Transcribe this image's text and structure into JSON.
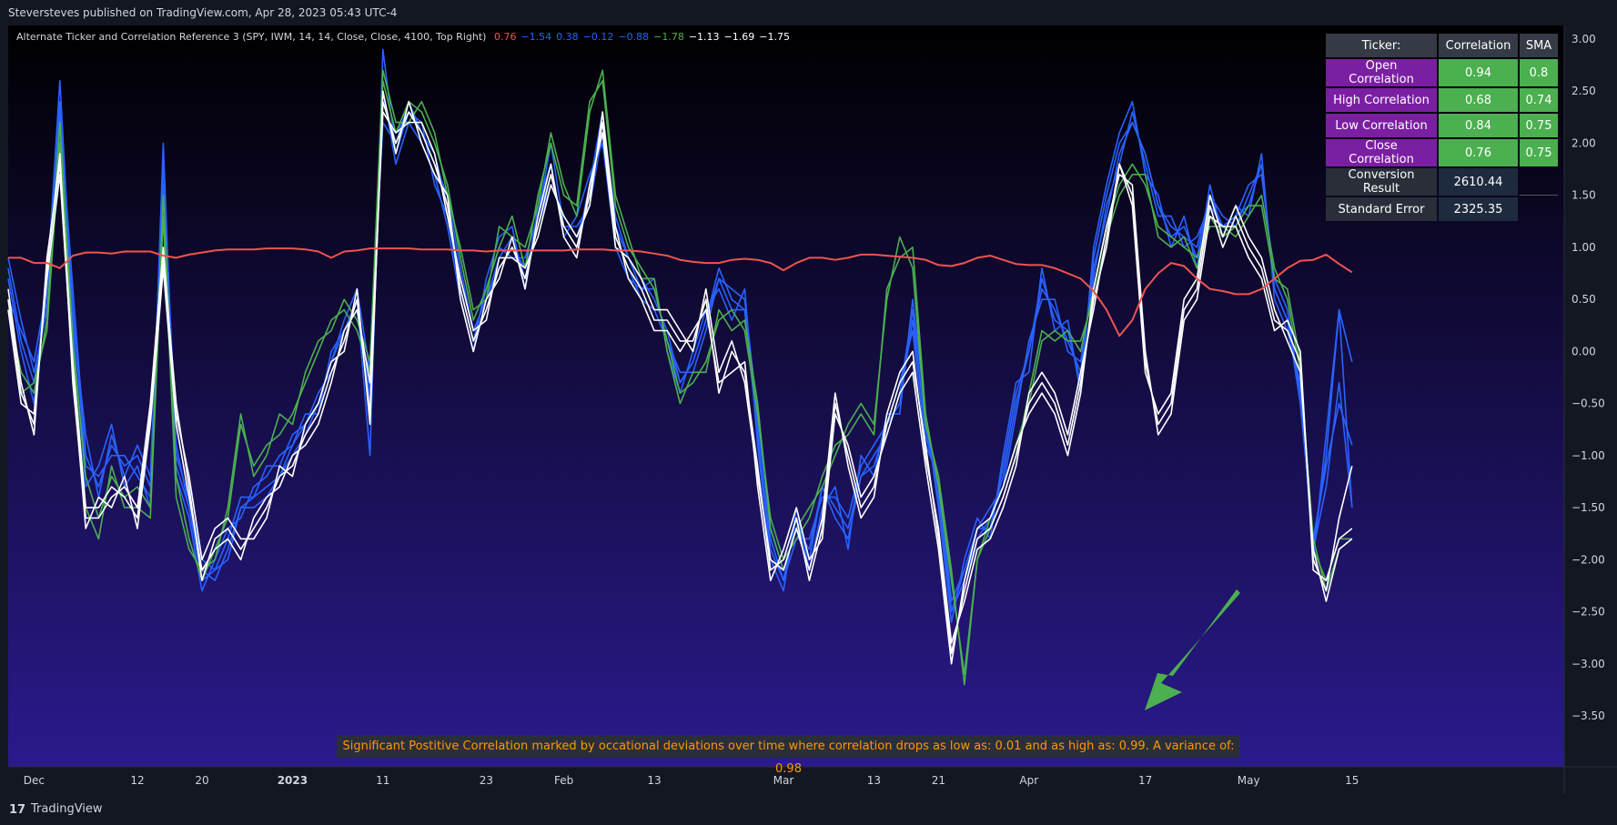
{
  "header": {
    "published": "Steversteves published on TradingView.com, Apr 28, 2023 05:43 UTC-4"
  },
  "legend": {
    "title": "Alternate Ticker and Correlation Reference 3 (SPY, IWM, 14, 14, Close, Close, 4100, Top Right)",
    "values": [
      {
        "text": "0.76",
        "color": "#ef5350"
      },
      {
        "text": "−1.54",
        "color": "#2962ff"
      },
      {
        "text": "0.38",
        "color": "#2962ff"
      },
      {
        "text": "−0.12",
        "color": "#2962ff"
      },
      {
        "text": "−0.88",
        "color": "#2962ff"
      },
      {
        "text": "−1.78",
        "color": "#4caf50"
      },
      {
        "text": "−1.13",
        "color": "#ffffff"
      },
      {
        "text": "−1.69",
        "color": "#ffffff"
      },
      {
        "text": "−1.75",
        "color": "#ffffff"
      }
    ]
  },
  "table": {
    "headers": [
      "Ticker:",
      "Correlation",
      "SMA"
    ],
    "rows": [
      {
        "label": "Open Correlation",
        "corr": "0.94",
        "sma": "0.8"
      },
      {
        "label": "High Correlation",
        "corr": "0.68",
        "sma": "0.74"
      },
      {
        "label": "Low Correlation",
        "corr": "0.84",
        "sma": "0.75"
      },
      {
        "label": "Close Correlation",
        "corr": "0.76",
        "sma": "0.75"
      }
    ],
    "conversion": {
      "label": "Conversion Result",
      "value": "2610.44"
    },
    "stderr": {
      "label": "Standard Error",
      "value": "2325.35"
    }
  },
  "annotation": "Significant Postitive Correlation marked by occational deviations over time where correlation drops as low as: 0.01 and as high as: 0.99. A variance of: 0.98",
  "footer": {
    "brand": "TradingView",
    "logo_text": "17"
  },
  "colors": {
    "correlation": "#ef5350",
    "blue": "#2962ff",
    "green": "#4caf50",
    "white": "#ffffff",
    "arrow": "#4caf50",
    "bg_top": "#000000",
    "bg_bottom": "#2a1a8c"
  },
  "chart_data": {
    "type": "line",
    "ylim": [
      -3.5,
      3.0
    ],
    "y_ticks": [
      "3.00",
      "2.50",
      "2.00",
      "1.50",
      "1.00",
      "0.50",
      "0.00",
      "−0.50",
      "−1.00",
      "−1.50",
      "−2.00",
      "−2.50",
      "−3.00",
      "−3.50"
    ],
    "x_ticks": [
      "Dec",
      "12",
      "20",
      "2023",
      "11",
      "23",
      "Feb",
      "13",
      "Mar",
      "13",
      "21",
      "Apr",
      "17",
      "May",
      "15"
    ],
    "bold_x_ticks": [
      "2023"
    ],
    "sessions_visible": 105,
    "x_tick_sessions": [
      2,
      10,
      15,
      22,
      29,
      37,
      43,
      50,
      60,
      67,
      72,
      79,
      88,
      96,
      104
    ],
    "series": [
      {
        "color": "blue",
        "values": [
          0.9,
          0.3,
          -0.2,
          0.4,
          2.3,
          0.6,
          -1.0,
          -1.3,
          -0.9,
          -1.1,
          -1.0,
          -1.3,
          1.8,
          -0.9,
          -1.5,
          -2.1,
          -2.2,
          -1.9,
          -1.5,
          -1.5,
          -1.4,
          -1.2,
          -1.0,
          -0.8,
          -0.5,
          -0.1,
          0.3,
          0.6,
          -0.2,
          2.2,
          2.0,
          2.4,
          2.1,
          1.8,
          1.5,
          0.8,
          0.2,
          0.5,
          0.8,
          1.0,
          0.8,
          1.2,
          1.6,
          1.3,
          1.1,
          1.5,
          2.2,
          1.3,
          0.9,
          0.7,
          0.5,
          0.2,
          -0.3,
          -0.1,
          0.3,
          0.8,
          0.5,
          0.4,
          -0.7,
          -1.7,
          -2.1,
          -1.7,
          -1.9,
          -1.3,
          -1.5,
          -1.7,
          -1.2,
          -1.0,
          -0.8,
          -0.4,
          0.4,
          -0.8,
          -1.3,
          -2.5,
          -2.2,
          -1.8,
          -1.6,
          -1.2,
          -0.5,
          0.0,
          0.6,
          0.4,
          0.1,
          -0.2,
          0.8,
          1.3,
          1.9,
          2.2,
          1.9,
          1.4,
          1.2,
          1.1,
          1.0,
          1.5,
          1.3,
          1.2,
          1.5,
          1.8,
          0.6,
          0.3,
          -0.5,
          -1.8,
          -1.1,
          -0.5,
          -0.9
        ]
      },
      {
        "color": "blue",
        "values": [
          0.7,
          0.0,
          -0.5,
          0.8,
          2.1,
          0.2,
          -1.3,
          -1.1,
          -0.7,
          -1.3,
          -1.1,
          -1.5,
          2.0,
          -1.2,
          -1.6,
          -2.3,
          -2.0,
          -1.7,
          -1.6,
          -1.3,
          -1.2,
          -1.0,
          -0.9,
          -0.6,
          -0.6,
          0.0,
          0.2,
          0.4,
          -0.5,
          2.5,
          1.8,
          2.2,
          2.0,
          1.7,
          1.2,
          0.5,
          0.0,
          0.7,
          1.1,
          1.2,
          0.6,
          1.4,
          1.8,
          1.1,
          1.3,
          1.7,
          2.0,
          1.0,
          0.7,
          0.6,
          0.7,
          0.0,
          -0.4,
          0.0,
          0.4,
          0.6,
          0.3,
          0.6,
          -0.9,
          -2.0,
          -2.3,
          -1.5,
          -2.1,
          -1.5,
          -1.3,
          -1.9,
          -1.0,
          -1.2,
          -0.6,
          -0.6,
          0.5,
          -0.6,
          -1.5,
          -2.6,
          -2.0,
          -1.6,
          -1.8,
          -1.0,
          -0.3,
          -0.2,
          0.8,
          0.2,
          0.3,
          -0.4,
          1.0,
          1.6,
          2.1,
          2.4,
          1.7,
          1.5,
          1.0,
          1.3,
          0.8,
          1.6,
          1.1,
          1.4,
          1.3,
          1.9,
          0.5,
          0.2,
          -0.3,
          -2.0,
          -0.8,
          0.4,
          -0.1
        ]
      },
      {
        "color": "blue",
        "values": [
          0.5,
          0.2,
          -0.1,
          0.6,
          2.6,
          0.3,
          -0.8,
          -1.4,
          -0.8,
          -1.2,
          -0.9,
          -1.2,
          1.6,
          -1.0,
          -1.4,
          -2.0,
          -2.1,
          -1.8,
          -1.4,
          -1.4,
          -1.1,
          -1.1,
          -0.8,
          -0.7,
          -0.4,
          -0.2,
          0.1,
          0.5,
          -1.0,
          2.9,
          1.9,
          2.3,
          2.2,
          1.6,
          1.3,
          0.6,
          0.1,
          0.6,
          1.0,
          0.9,
          0.9,
          1.3,
          2.0,
          1.2,
          1.0,
          1.6,
          2.3,
          1.1,
          0.8,
          0.5,
          0.4,
          0.1,
          -0.2,
          -0.2,
          0.2,
          0.7,
          0.6,
          0.5,
          -0.6,
          -1.8,
          -2.2,
          -1.8,
          -1.8,
          -1.4,
          -1.4,
          -1.6,
          -1.1,
          -0.9,
          -0.7,
          -0.3,
          0.2,
          -0.9,
          -1.2,
          -2.4,
          -2.1,
          -1.7,
          -1.5,
          -1.3,
          -0.6,
          0.1,
          0.5,
          0.5,
          0.0,
          -0.1,
          0.7,
          1.4,
          1.8,
          2.3,
          1.8,
          1.3,
          1.3,
          1.0,
          1.1,
          1.4,
          1.2,
          1.3,
          1.6,
          1.7,
          0.7,
          0.4,
          -0.4,
          -1.9,
          -1.3,
          -0.3,
          -1.5
        ]
      },
      {
        "color": "blue",
        "values": [
          0.8,
          0.1,
          -0.3,
          0.5,
          2.4,
          0.4,
          -1.1,
          -1.2,
          -1.0,
          -1.0,
          -1.2,
          -1.4,
          1.9,
          -1.1,
          -1.5,
          -2.2,
          -2.1,
          -2.0,
          -1.5,
          -1.4,
          -1.3,
          -1.2,
          -0.9,
          -0.7,
          -0.5,
          -0.1,
          0.2,
          0.5,
          -0.4,
          2.3,
          2.1,
          2.3,
          2.1,
          1.9,
          1.4,
          0.7,
          0.2,
          0.5,
          0.9,
          1.1,
          0.7,
          1.3,
          1.7,
          1.2,
          1.2,
          1.4,
          2.1,
          1.2,
          0.9,
          0.6,
          0.6,
          0.1,
          -0.3,
          -0.1,
          0.3,
          0.7,
          0.4,
          0.4,
          -0.8,
          -1.9,
          -2.2,
          -1.6,
          -2.0,
          -1.3,
          -1.6,
          -1.8,
          -1.2,
          -1.1,
          -0.7,
          -0.5,
          0.3,
          -0.7,
          -1.4,
          -2.5,
          -2.1,
          -1.7,
          -1.7,
          -1.1,
          -0.4,
          0.0,
          0.7,
          0.3,
          0.2,
          -0.3,
          0.9,
          1.5,
          2.0,
          2.2,
          1.9,
          1.4,
          1.1,
          1.2,
          0.9,
          1.5,
          1.2,
          1.3,
          1.4,
          1.8,
          0.6,
          0.3,
          -0.4,
          -1.9,
          -1.0,
          0.4,
          -1.5
        ]
      },
      {
        "color": "green",
        "values": [
          0.4,
          -0.2,
          -0.4,
          0.3,
          2.2,
          0.1,
          -1.2,
          -1.6,
          -1.2,
          -1.4,
          -1.3,
          -1.5,
          1.5,
          -1.2,
          -1.8,
          -2.2,
          -1.9,
          -1.6,
          -0.7,
          -1.1,
          -0.9,
          -0.8,
          -0.6,
          -0.3,
          0.0,
          0.3,
          0.4,
          0.2,
          -0.2,
          2.6,
          2.1,
          2.4,
          2.3,
          2.0,
          1.6,
          0.9,
          0.3,
          0.6,
          1.0,
          1.3,
          0.8,
          1.5,
          2.0,
          1.5,
          1.4,
          2.4,
          2.6,
          1.4,
          1.0,
          0.8,
          0.6,
          0.1,
          -0.4,
          -0.3,
          -0.1,
          0.3,
          0.4,
          0.2,
          -0.6,
          -1.6,
          -2.0,
          -1.8,
          -1.6,
          -1.2,
          -0.9,
          -0.8,
          -0.6,
          -0.8,
          0.6,
          0.9,
          1.0,
          -0.6,
          -1.3,
          -2.2,
          -3.1,
          -2.0,
          -1.7,
          -1.4,
          -1.0,
          -0.4,
          0.2,
          0.1,
          0.2,
          0.0,
          0.6,
          1.2,
          1.6,
          1.8,
          1.6,
          1.2,
          1.1,
          1.0,
          0.9,
          1.2,
          1.2,
          1.1,
          1.3,
          1.5,
          0.8,
          0.5,
          -0.2,
          -1.8,
          -2.3,
          -1.9,
          -1.8
        ]
      },
      {
        "color": "green",
        "values": [
          0.5,
          -0.4,
          -0.3,
          0.2,
          2.0,
          0.0,
          -1.5,
          -1.8,
          -1.1,
          -1.5,
          -1.5,
          -1.6,
          1.3,
          -1.4,
          -1.9,
          -2.1,
          -2.0,
          -1.5,
          -0.6,
          -1.2,
          -1.0,
          -0.6,
          -0.7,
          -0.2,
          0.1,
          0.2,
          0.5,
          0.3,
          -0.1,
          2.7,
          2.2,
          2.2,
          2.4,
          2.1,
          1.5,
          1.0,
          0.4,
          0.5,
          1.2,
          1.1,
          1.0,
          1.4,
          2.1,
          1.6,
          1.3,
          2.3,
          2.7,
          1.5,
          1.1,
          0.7,
          0.7,
          0.0,
          -0.5,
          -0.2,
          -0.2,
          0.4,
          0.2,
          0.3,
          -0.5,
          -1.7,
          -2.1,
          -1.7,
          -1.5,
          -1.3,
          -1.0,
          -0.7,
          -0.5,
          -0.7,
          0.5,
          1.1,
          0.8,
          -0.7,
          -1.2,
          -2.1,
          -3.2,
          -2.0,
          -1.6,
          -1.3,
          -0.9,
          -0.5,
          0.1,
          0.2,
          0.1,
          0.1,
          0.5,
          1.1,
          1.5,
          1.7,
          1.7,
          1.1,
          1.0,
          1.1,
          0.8,
          1.3,
          1.1,
          1.2,
          1.4,
          1.4,
          0.7,
          0.6,
          -0.1,
          -1.9,
          -2.2,
          -1.8,
          -1.8
        ]
      },
      {
        "color": "white",
        "values": [
          0.6,
          -0.3,
          -0.8,
          0.9,
          1.8,
          -0.1,
          -1.5,
          -1.5,
          -1.3,
          -1.4,
          -1.6,
          -0.6,
          0.9,
          -0.5,
          -1.3,
          -2.2,
          -1.8,
          -1.7,
          -1.9,
          -1.7,
          -1.5,
          -1.2,
          -1.1,
          -0.8,
          -0.6,
          -0.2,
          0.1,
          0.5,
          -0.6,
          2.4,
          2.0,
          2.3,
          2.1,
          1.8,
          1.4,
          0.6,
          0.1,
          0.4,
          0.8,
          1.0,
          0.7,
          1.2,
          1.7,
          1.2,
          1.0,
          1.5,
          2.2,
          1.1,
          0.8,
          0.6,
          0.3,
          0.3,
          0.1,
          0.1,
          0.5,
          -0.4,
          0.0,
          -0.2,
          -1.1,
          -2.1,
          -2.0,
          -1.6,
          -2.2,
          -1.7,
          -0.5,
          -1.0,
          -1.5,
          -1.3,
          -0.7,
          -0.3,
          -0.1,
          -0.9,
          -1.8,
          -2.9,
          -2.3,
          -1.8,
          -1.7,
          -1.4,
          -1.0,
          -0.5,
          -0.3,
          -0.5,
          -0.9,
          -0.3,
          0.5,
          1.0,
          1.8,
          1.5,
          -0.1,
          -0.7,
          -0.5,
          0.4,
          0.6,
          1.4,
          1.0,
          1.3,
          1.0,
          0.8,
          0.3,
          0.2,
          -0.1,
          -2.0,
          -2.3,
          -1.6,
          -1.1
        ]
      },
      {
        "color": "white",
        "values": [
          0.4,
          -0.5,
          -0.6,
          0.7,
          1.7,
          -0.2,
          -1.7,
          -1.4,
          -1.5,
          -1.2,
          -1.7,
          -0.7,
          0.8,
          -0.7,
          -1.4,
          -2.1,
          -1.9,
          -1.8,
          -2.0,
          -1.6,
          -1.4,
          -1.3,
          -1.0,
          -0.9,
          -0.7,
          -0.3,
          0.2,
          0.4,
          -0.3,
          2.3,
          2.1,
          2.2,
          2.2,
          1.9,
          1.3,
          0.7,
          0.2,
          0.3,
          0.9,
          0.9,
          0.8,
          1.1,
          1.6,
          1.3,
          1.1,
          1.4,
          2.3,
          1.2,
          0.7,
          0.5,
          0.2,
          0.2,
          0.0,
          0.2,
          0.4,
          -0.3,
          -0.2,
          -0.1,
          -1.3,
          -2.2,
          -1.9,
          -1.5,
          -2.0,
          -1.8,
          -0.6,
          -0.9,
          -1.4,
          -1.2,
          -0.8,
          -0.4,
          -0.2,
          -1.1,
          -1.9,
          -3.0,
          -2.2,
          -1.7,
          -1.6,
          -1.3,
          -0.9,
          -0.6,
          -0.4,
          -0.6,
          -1.0,
          -0.4,
          0.6,
          1.2,
          1.7,
          1.6,
          0.0,
          -0.8,
          -0.6,
          0.3,
          0.5,
          1.3,
          1.2,
          1.2,
          0.9,
          0.7,
          0.2,
          0.3,
          0.0,
          -2.1,
          -2.2,
          -1.8,
          -1.7
        ]
      },
      {
        "color": "white",
        "values": [
          0.5,
          -0.4,
          -0.7,
          0.8,
          1.9,
          -0.3,
          -1.6,
          -1.6,
          -1.4,
          -1.3,
          -1.5,
          -0.5,
          1.0,
          -0.6,
          -1.2,
          -2.0,
          -1.7,
          -1.6,
          -1.8,
          -1.8,
          -1.6,
          -1.1,
          -1.2,
          -0.7,
          -0.5,
          -0.1,
          0.0,
          0.6,
          -0.7,
          2.5,
          1.9,
          2.4,
          2.0,
          1.7,
          1.5,
          0.5,
          0.0,
          0.5,
          0.7,
          1.1,
          0.6,
          1.3,
          1.8,
          1.1,
          0.9,
          1.6,
          2.1,
          1.0,
          0.9,
          0.7,
          0.4,
          0.4,
          0.2,
          0.0,
          0.6,
          -0.2,
          0.1,
          -0.3,
          -1.2,
          -2.0,
          -2.1,
          -1.7,
          -2.1,
          -1.6,
          -0.4,
          -1.1,
          -1.6,
          -1.4,
          -0.6,
          -0.2,
          0.0,
          -1.0,
          -1.7,
          -2.8,
          -2.4,
          -1.9,
          -1.8,
          -1.5,
          -1.1,
          -0.4,
          -0.2,
          -0.4,
          -0.8,
          -0.2,
          0.4,
          1.1,
          1.8,
          1.4,
          -0.2,
          -0.6,
          -0.4,
          0.5,
          0.7,
          1.5,
          1.1,
          1.4,
          1.1,
          0.9,
          0.4,
          0.1,
          -0.2,
          -1.9,
          -2.4,
          -1.9,
          -1.8
        ]
      },
      {
        "color": "correlation",
        "values": [
          0.9,
          0.9,
          0.85,
          0.85,
          0.8,
          0.92,
          0.95,
          0.95,
          0.94,
          0.96,
          0.96,
          0.96,
          0.92,
          0.9,
          0.93,
          0.95,
          0.97,
          0.98,
          0.98,
          0.98,
          0.99,
          0.99,
          0.99,
          0.98,
          0.96,
          0.9,
          0.96,
          0.97,
          0.99,
          0.99,
          0.99,
          0.99,
          0.98,
          0.98,
          0.98,
          0.97,
          0.97,
          0.96,
          0.97,
          0.97,
          0.97,
          0.97,
          0.97,
          0.97,
          0.98,
          0.98,
          0.98,
          0.97,
          0.97,
          0.96,
          0.94,
          0.92,
          0.88,
          0.86,
          0.85,
          0.85,
          0.88,
          0.89,
          0.88,
          0.85,
          0.78,
          0.85,
          0.9,
          0.9,
          0.88,
          0.9,
          0.93,
          0.93,
          0.92,
          0.91,
          0.9,
          0.88,
          0.83,
          0.82,
          0.85,
          0.9,
          0.92,
          0.88,
          0.84,
          0.83,
          0.83,
          0.8,
          0.75,
          0.7,
          0.58,
          0.4,
          0.15,
          0.3,
          0.6,
          0.75,
          0.85,
          0.82,
          0.7,
          0.6,
          0.58,
          0.55,
          0.55,
          0.6,
          0.7,
          0.8,
          0.87,
          0.88,
          0.93,
          0.84,
          0.76
        ]
      }
    ]
  }
}
